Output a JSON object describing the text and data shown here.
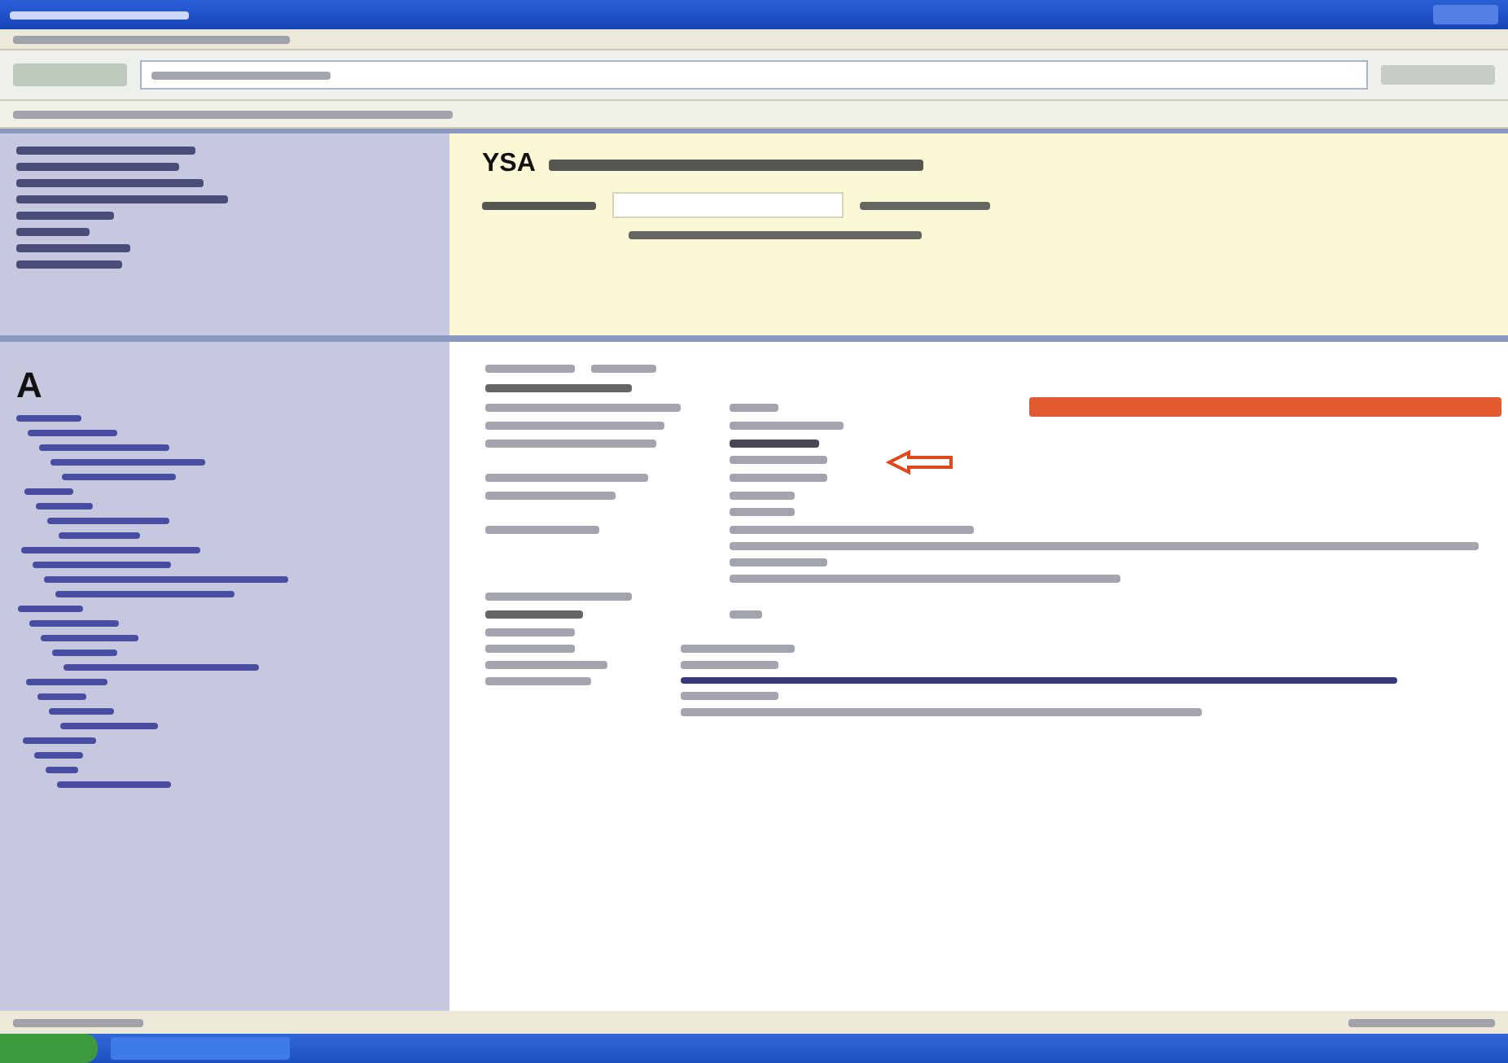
{
  "page_header": {
    "code": "YSA"
  },
  "index": {
    "letter": "A"
  }
}
